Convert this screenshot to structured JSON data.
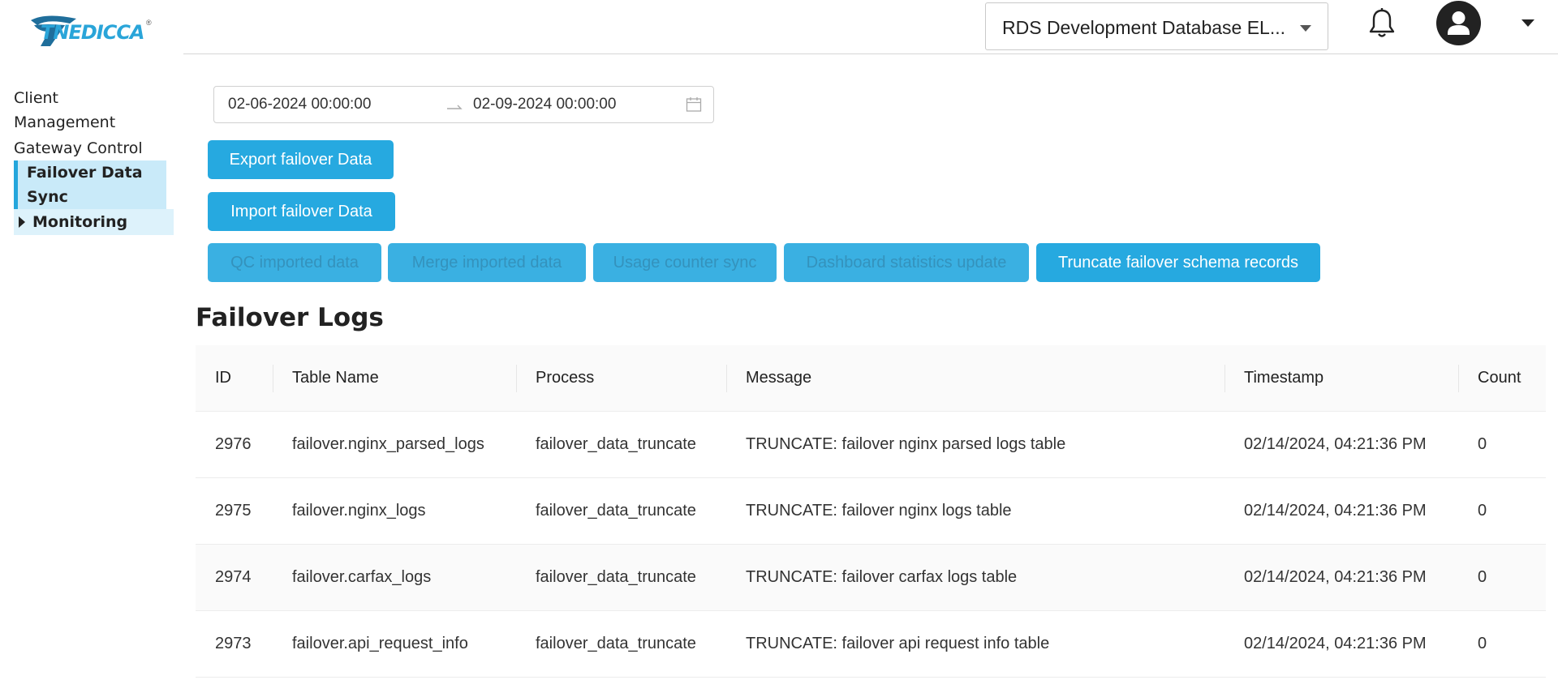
{
  "header": {
    "logo_text": "TNEDICCA",
    "logo_registered": "®",
    "database_select": "RDS Development Database EL...",
    "icons": [
      "bell-icon",
      "user-avatar-icon",
      "caret-down-icon"
    ]
  },
  "sidebar": {
    "items": [
      {
        "label": "Client Management"
      },
      {
        "label": "Gateway Control"
      },
      {
        "label": "Failover Data Sync",
        "active": true
      },
      {
        "label": "Monitoring",
        "group": true
      }
    ]
  },
  "date_range": {
    "start": "02-06-2024 00:00:00",
    "end": "02-09-2024 00:00:00"
  },
  "buttons": {
    "export": "Export failover Data",
    "import": "Import failover Data",
    "qc": "QC imported data",
    "merge": "Merge imported data",
    "usage": "Usage counter sync",
    "dashboard": "Dashboard statistics update",
    "truncate": "Truncate failover schema records"
  },
  "logs": {
    "title": "Failover Logs",
    "columns": [
      "ID",
      "Table Name",
      "Process",
      "Message",
      "Timestamp",
      "Count"
    ],
    "rows": [
      [
        "2976",
        "failover.nginx_parsed_logs",
        "failover_data_truncate",
        "TRUNCATE: failover nginx parsed logs table",
        "02/14/2024, 04:21:36 PM",
        "0"
      ],
      [
        "2975",
        "failover.nginx_logs",
        "failover_data_truncate",
        "TRUNCATE: failover nginx logs table",
        "02/14/2024, 04:21:36 PM",
        "0"
      ],
      [
        "2974",
        "failover.carfax_logs",
        "failover_data_truncate",
        "TRUNCATE: failover carfax logs table",
        "02/14/2024, 04:21:36 PM",
        "0"
      ],
      [
        "2973",
        "failover.api_request_info",
        "failover_data_truncate",
        "TRUNCATE: failover api request info table",
        "02/14/2024, 04:21:36 PM",
        "0"
      ]
    ]
  },
  "colors": {
    "accent": "#26a9e0",
    "sidebar_active_bg": "#c9eaf9"
  }
}
